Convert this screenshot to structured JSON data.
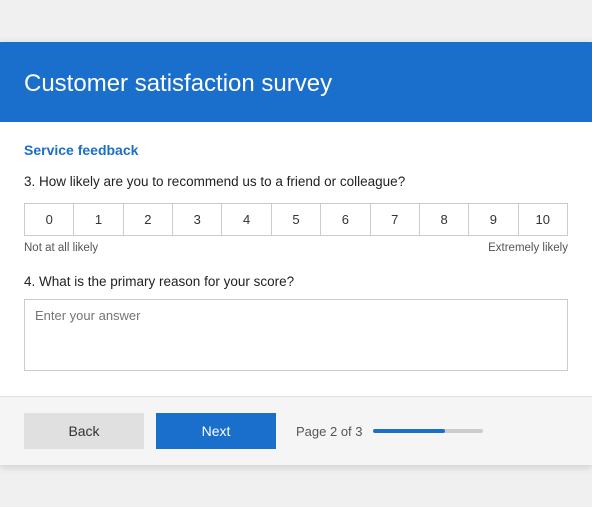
{
  "header": {
    "title": "Customer satisfaction survey"
  },
  "section": {
    "label": "Service feedback"
  },
  "question3": {
    "text": "3. How likely are you to recommend us to a friend or colleague?",
    "scale": [
      "0",
      "1",
      "2",
      "3",
      "4",
      "5",
      "6",
      "7",
      "8",
      "9",
      "10"
    ],
    "label_left": "Not at all likely",
    "label_right": "Extremely likely"
  },
  "question4": {
    "text": "4. What is the primary reason for your score?",
    "placeholder": "Enter your answer"
  },
  "footer": {
    "back_label": "Back",
    "next_label": "Next",
    "page_label": "Page 2 of 3",
    "progress_percent": 66
  }
}
